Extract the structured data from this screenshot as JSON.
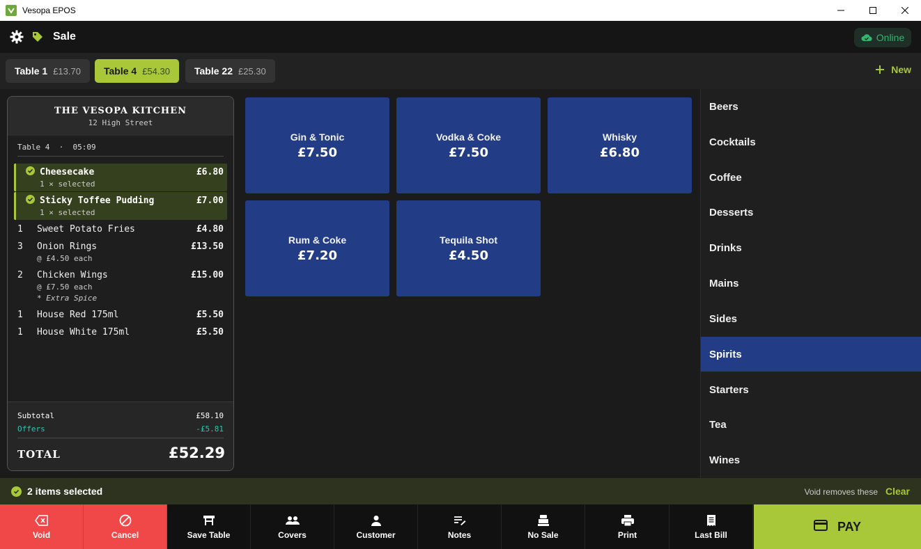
{
  "window": {
    "title": "Vesopa EPOS"
  },
  "header": {
    "title": "Sale",
    "status": "Online"
  },
  "tabs": [
    {
      "name": "Table 1",
      "amount": "£13.70"
    },
    {
      "name": "Table 4",
      "amount": "£54.30"
    },
    {
      "name": "Table 22",
      "amount": "£25.30"
    }
  ],
  "new_label": "New",
  "receipt": {
    "shop": "THE VESOPA KITCHEN",
    "address": "12 High Street",
    "table": "Table 4",
    "separator": "·",
    "time": "05:09",
    "selected": [
      {
        "name": "Cheesecake",
        "price": "£6.80",
        "sub": "1 × selected"
      },
      {
        "name": "Sticky Toffee Pudding",
        "price": "£7.00",
        "sub": "1 × selected"
      }
    ],
    "lines": [
      {
        "qty": "1",
        "name": "Sweet Potato Fries",
        "price": "£4.80"
      },
      {
        "qty": "3",
        "name": "Onion Rings",
        "price": "£13.50",
        "sub": "@ £4.50 each"
      },
      {
        "qty": "2",
        "name": "Chicken Wings",
        "price": "£15.00",
        "sub": "@ £7.50 each",
        "mod": "* Extra Spice"
      },
      {
        "qty": "1",
        "name": "House Red 175ml",
        "price": "£5.50"
      },
      {
        "qty": "1",
        "name": "House White 175ml",
        "price": "£5.50"
      }
    ],
    "subtotal_label": "Subtotal",
    "subtotal": "£58.10",
    "offers_label": "Offers",
    "offers": "-£5.81",
    "total_label": "TOTAL",
    "total": "£52.29"
  },
  "products": [
    {
      "name": "Gin & Tonic",
      "price": "£7.50"
    },
    {
      "name": "Vodka & Coke",
      "price": "£7.50"
    },
    {
      "name": "Whisky",
      "price": "£6.80"
    },
    {
      "name": "Rum & Coke",
      "price": "£7.20"
    },
    {
      "name": "Tequila Shot",
      "price": "£4.50"
    }
  ],
  "categories": [
    "Beers",
    "Cocktails",
    "Coffee",
    "Desserts",
    "Drinks",
    "Mains",
    "Sides",
    "Spirits",
    "Starters",
    "Tea",
    "Wines"
  ],
  "active_category": "Spirits",
  "selection": {
    "count": "2 items selected",
    "hint": "Void removes these",
    "clear": "Clear"
  },
  "actions": {
    "void": "Void",
    "cancel": "Cancel",
    "save_table": "Save Table",
    "covers": "Covers",
    "customer": "Customer",
    "notes": "Notes",
    "no_sale": "No Sale",
    "print": "Print",
    "last_bill": "Last Bill",
    "pay": "PAY"
  },
  "colors": {
    "accent": "#a8c83a",
    "product": "#223d86",
    "danger": "#f04848",
    "online": "#33b56e",
    "offers": "#2fc3b0"
  }
}
